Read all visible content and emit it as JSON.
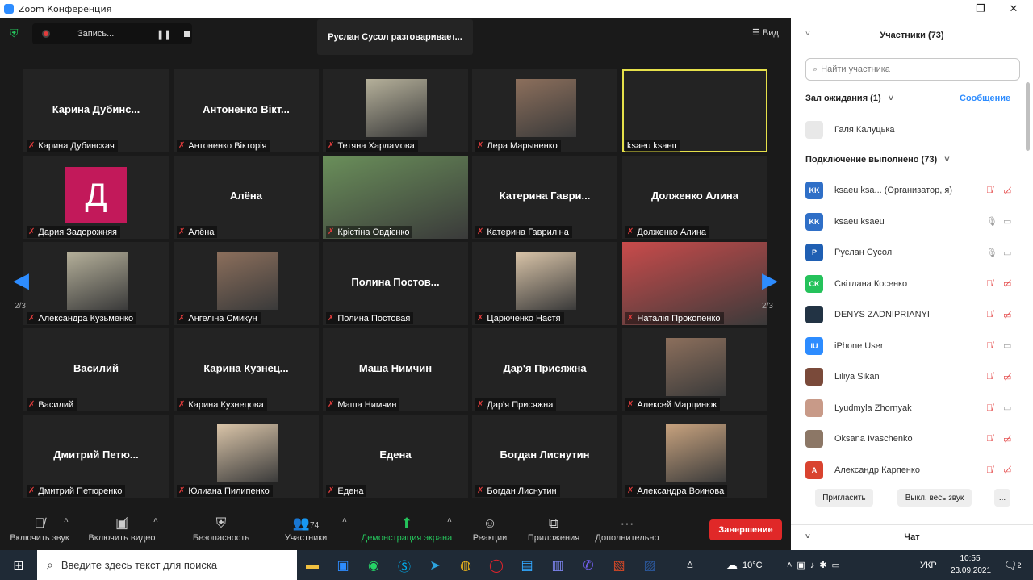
{
  "window": {
    "title": "Zoom Конференция",
    "min": "—",
    "max": "❐",
    "close": "✕"
  },
  "topbar": {
    "recording_label": "Запись...",
    "speaking_banner": "Руслан Сусол разговаривает...",
    "view_label": "Вид",
    "page_left": "2/3",
    "page_right": "2/3"
  },
  "tiles": [
    {
      "big": "Карина  Дубинс...",
      "label": "Карина Дубинская",
      "img": ""
    },
    {
      "big": "Антоненко  Вікт...",
      "label": "Антоненко Вікторія",
      "img": ""
    },
    {
      "big": "",
      "label": "Тетяна Харламова",
      "img": "photo"
    },
    {
      "big": "",
      "label": "Лера Марыненко",
      "img": "photo"
    },
    {
      "big": "",
      "label": "ksaeu ksaeu",
      "img": "",
      "speaker": true
    },
    {
      "big": "",
      "label": "Дария Задорожняя",
      "img": "avatar",
      "avatar_letter": "Д"
    },
    {
      "big": "Алёна",
      "label": "Алёна",
      "img": ""
    },
    {
      "big": "",
      "label": "Крістіна Овдієнко",
      "img": "video"
    },
    {
      "big": "Катерина  Гаври...",
      "label": "Катерина Гавриліна",
      "img": ""
    },
    {
      "big": "Долженко Алина",
      "label": "Долженко Алина",
      "img": ""
    },
    {
      "big": "",
      "label": "Александра Кузьменко",
      "img": "photo"
    },
    {
      "big": "",
      "label": "Ангеліна Смикун",
      "img": "photo"
    },
    {
      "big": "Полина  Постов...",
      "label": "Полина Постовая",
      "img": ""
    },
    {
      "big": "",
      "label": "Царюченко Настя",
      "img": "photo"
    },
    {
      "big": "",
      "label": "Наталія Прокопенко",
      "img": "video"
    },
    {
      "big": "Василий",
      "label": "Василий",
      "img": ""
    },
    {
      "big": "Карина  Кузнец...",
      "label": "Карина Кузнецова",
      "img": ""
    },
    {
      "big": "Маша Нимчин",
      "label": "Маша Нимчин",
      "img": ""
    },
    {
      "big": "Дар'я Присяжна",
      "label": "Дар'я Присяжна",
      "img": ""
    },
    {
      "big": "",
      "label": "Алексей Марцинюк",
      "img": "photo"
    },
    {
      "big": "Дмитрий  Петю...",
      "label": "Дмитрий Петюренко",
      "img": ""
    },
    {
      "big": "",
      "label": "Юлиана Пилипенко",
      "img": "photo"
    },
    {
      "big": "Едена",
      "label": "Едена",
      "img": ""
    },
    {
      "big": "Богдан Лиснутин",
      "label": "Богдан Лиснутин",
      "img": ""
    },
    {
      "big": "",
      "label": "Александра Воинова",
      "img": "photo"
    }
  ],
  "toolbar": {
    "mic": "Включить звук",
    "video": "Включить видео",
    "security": "Безопасность",
    "participants": "Участники",
    "participants_count": "74",
    "share": "Демонстрация экрана",
    "reactions": "Реакции",
    "apps": "Приложения",
    "more": "Дополнительно",
    "end": "Завершение"
  },
  "panel": {
    "title": "Участники (73)",
    "search_placeholder": "Найти участника",
    "waiting_title": "Зал ожидания (1)",
    "message_link": "Сообщение",
    "waiting_person": "Галя Калуцька",
    "connected_title": "Подключение выполнено (73)",
    "participants": [
      {
        "initials": "KK",
        "name": "ksaeu ksa...  (Организатор, я)",
        "color": "#2f6fc7",
        "mic": "off",
        "cam": "off"
      },
      {
        "initials": "KK",
        "name": "ksaeu ksaeu",
        "color": "#2f6fc7",
        "mic": "on",
        "cam": "on"
      },
      {
        "initials": "P",
        "name": "Руслан Сусол",
        "color": "#1f5fb3",
        "mic": "on",
        "cam": "on"
      },
      {
        "initials": "CK",
        "name": "Світлана Косенко",
        "color": "#25c25b",
        "mic": "off",
        "cam": "off"
      },
      {
        "initials": "",
        "name": "DENYS ZADNIPRIANYI",
        "color": "#223344",
        "mic": "off",
        "cam": "off"
      },
      {
        "initials": "IU",
        "name": "iPhone User",
        "color": "#2d8cff",
        "mic": "off",
        "cam": "on"
      },
      {
        "initials": "",
        "name": "Liliya Sikan",
        "color": "#7a4a3a",
        "mic": "off",
        "cam": "off"
      },
      {
        "initials": "",
        "name": "Lyudmyla Zhornyak",
        "color": "#c89a88",
        "mic": "off",
        "cam": "on"
      },
      {
        "initials": "",
        "name": "Oksana Ivaschenko",
        "color": "#8c7766",
        "mic": "off",
        "cam": "off"
      },
      {
        "initials": "A",
        "name": "Александр Карпенко",
        "color": "#d9432f",
        "mic": "off",
        "cam": "off"
      }
    ],
    "invite": "Пригласить",
    "mute_all": "Выкл. весь звук",
    "more": "...",
    "chat": "Чат"
  },
  "taskbar": {
    "search_placeholder": "Введите здесь текст для поиска",
    "temperature": "10°C",
    "lang": "УКР",
    "time": "10:55",
    "date": "23.09.2021",
    "notifications": "2"
  }
}
